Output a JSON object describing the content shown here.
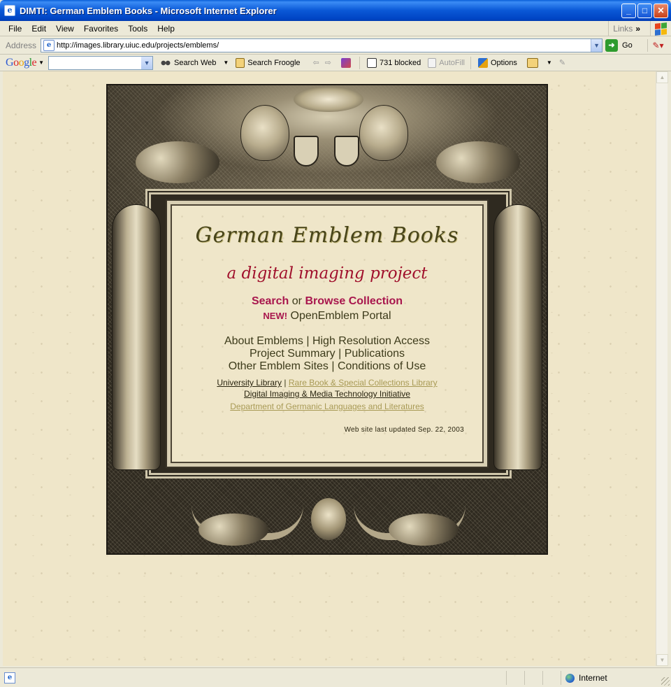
{
  "window": {
    "title": "DIMTI: German Emblem Books - Microsoft Internet Explorer",
    "buttons": {
      "minimize": "_",
      "maximize": "□",
      "close": "✕"
    }
  },
  "menu": {
    "items": [
      "File",
      "Edit",
      "View",
      "Favorites",
      "Tools",
      "Help"
    ],
    "links_label": "Links",
    "chevrons": "»"
  },
  "address": {
    "label": "Address",
    "url": "http://images.library.uiuc.edu/projects/emblems/",
    "go_label": "Go"
  },
  "google_toolbar": {
    "logo": [
      "G",
      "o",
      "o",
      "g",
      "l",
      "e"
    ],
    "search_value": "",
    "search_web": "Search Web",
    "search_froogle": "Search Froogle",
    "popups_blocked": "731 blocked",
    "autofill": "AutoFill",
    "options": "Options"
  },
  "page": {
    "title": "German Emblem Books",
    "subtitle": "a digital imaging project",
    "search_link": "Search",
    "or_text": "or",
    "browse_link": "Browse Collection",
    "new_badge": "NEW!",
    "portal_link": "OpenEmblem Portal",
    "nav_line1": "About Emblems | High Resolution Access",
    "nav_line2": "Project Summary | Publications",
    "nav_line3": "Other Emblem Sites | Conditions of Use",
    "univ_library": "University Library",
    "separator": "|",
    "rare_book": "Rare Book & Special Collections Library",
    "dimti": "Digital Imaging & Media Technology Initiative",
    "germanic": "Department of Germanic Languages and Literatures",
    "updated": "Web site last updated Sep. 22, 2003"
  },
  "status": {
    "text": "",
    "zone": "Internet"
  },
  "colors": {
    "accent_link": "#a8164d",
    "title_olive": "#47441a",
    "subtitle_red": "#a0102c",
    "parchment": "#efe6c9"
  }
}
